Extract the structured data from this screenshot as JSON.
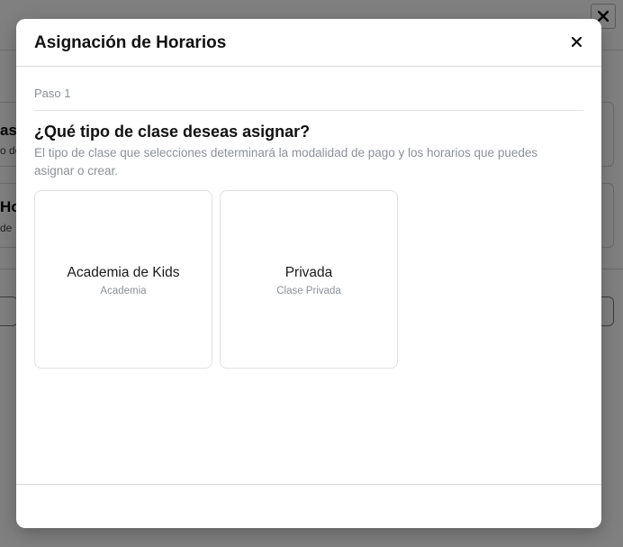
{
  "background": {
    "close_glyph": "✕",
    "card1_title": "as",
    "card1_sub": "o de",
    "card2_title": "Ho",
    "card2_sub": "de"
  },
  "modal": {
    "title": "Asignación de Horarios",
    "close_glyph": "✕",
    "step_label": "Paso 1",
    "question": "¿Qué tipo de clase deseas asignar?",
    "description": "El tipo de clase que selecciones determinará la modalidad de pago y los horarios que puedes asignar o crear.",
    "options": [
      {
        "title": "Academia de Kids",
        "subtitle": "Academia"
      },
      {
        "title": "Privada",
        "subtitle": "Clase Privada"
      }
    ]
  },
  "colors": {
    "overlay": "#808080",
    "modal_bg": "#ffffff",
    "muted_text": "#8c909a",
    "border": "#e1e1e1"
  }
}
